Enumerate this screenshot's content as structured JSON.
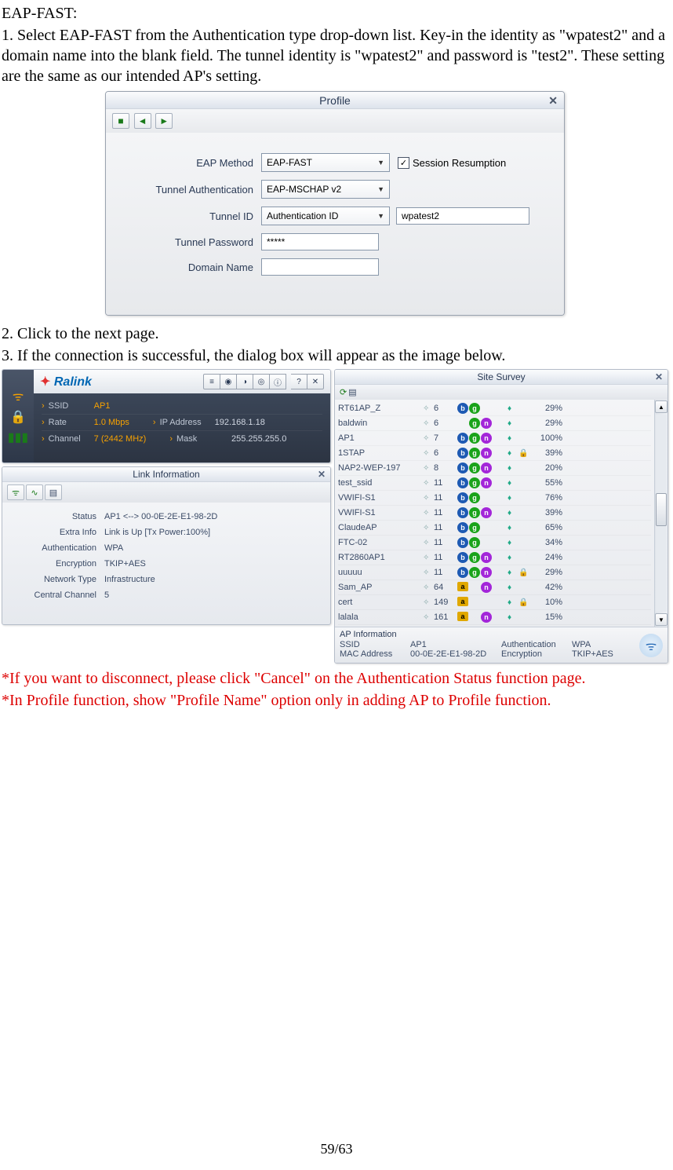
{
  "text": {
    "heading": "EAP-FAST:",
    "step1": "1. Select EAP-FAST from the Authentication type drop-down list. Key-in the identity as \"wpatest2\" and a domain name into the blank field. The tunnel identity is \"wpatest2\" and password is \"test2\". These setting are the same as our intended AP's setting.",
    "step2": "2. Click to the next page.",
    "step3": "3. If the connection is successful, the dialog box will appear as the image below.",
    "note1": "*If you want to disconnect, please click \"Cancel\" on the Authentication Status function page.",
    "note2": "*In Profile function, show \"Profile Name\" option only in adding AP to Profile function.",
    "pagenum": "59/63"
  },
  "profile": {
    "title": "Profile",
    "rows": {
      "eap_label": "EAP Method",
      "eap_value": "EAP-FAST",
      "session_label": "Session Resumption",
      "tunnel_auth_label": "Tunnel Authentication",
      "tunnel_auth_value": "EAP-MSCHAP v2",
      "tunnel_id_label": "Tunnel ID",
      "tunnel_id_value": "Authentication ID",
      "tunnel_id_input": "wpatest2",
      "tunnel_pw_label": "Tunnel Password",
      "tunnel_pw_value": "*****",
      "domain_label": "Domain Name",
      "domain_value": ""
    }
  },
  "ralink": {
    "logo": "Ralink",
    "ssid_label": "SSID",
    "ssid_value": "AP1",
    "rate_label": "Rate",
    "rate_value": "1.0 Mbps",
    "ip_label": "IP Address",
    "ip_value": "192.168.1.18",
    "channel_label": "Channel",
    "channel_value": "7 (2442 MHz)",
    "mask_label": "Mask",
    "mask_value": "255.255.255.0"
  },
  "linkinfo": {
    "title": "Link Information",
    "rows": [
      {
        "label": "Status",
        "value": "AP1 <--> 00-0E-2E-E1-98-2D"
      },
      {
        "label": "Extra Info",
        "value": "Link is Up [Tx Power:100%]"
      },
      {
        "label": "Authentication",
        "value": "WPA"
      },
      {
        "label": "Encryption",
        "value": "TKIP+AES"
      },
      {
        "label": "Network Type",
        "value": "Infrastructure"
      },
      {
        "label": "Central Channel",
        "value": "5"
      }
    ]
  },
  "site": {
    "title": "Site Survey",
    "rows": [
      {
        "ssid": "RT61AP_Z",
        "ch": "6",
        "badges": [
          "b",
          "g",
          "",
          ""
        ],
        "sec": "1",
        "lock": "",
        "pct": "29%"
      },
      {
        "ssid": "baldwin",
        "ch": "6",
        "badges": [
          "",
          "g",
          "n",
          ""
        ],
        "sec": "1",
        "lock": "",
        "pct": "29%"
      },
      {
        "ssid": "AP1",
        "ch": "7",
        "badges": [
          "b",
          "g",
          "n",
          ""
        ],
        "sec": "1",
        "lock": "",
        "pct": "100%"
      },
      {
        "ssid": "1STAP",
        "ch": "6",
        "badges": [
          "b",
          "g",
          "n",
          ""
        ],
        "sec": "1",
        "lock": "1",
        "pct": "39%"
      },
      {
        "ssid": "NAP2-WEP-197",
        "ch": "8",
        "badges": [
          "b",
          "g",
          "n",
          ""
        ],
        "sec": "1",
        "lock": "",
        "pct": "20%"
      },
      {
        "ssid": "test_ssid",
        "ch": "11",
        "badges": [
          "b",
          "g",
          "n",
          ""
        ],
        "sec": "1",
        "lock": "",
        "pct": "55%"
      },
      {
        "ssid": "VWIFI-S1",
        "ch": "11",
        "badges": [
          "b",
          "g",
          "",
          ""
        ],
        "sec": "1",
        "lock": "",
        "pct": "76%"
      },
      {
        "ssid": "VWIFI-S1",
        "ch": "11",
        "badges": [
          "b",
          "g",
          "n",
          ""
        ],
        "sec": "1",
        "lock": "",
        "pct": "39%"
      },
      {
        "ssid": "ClaudeAP",
        "ch": "11",
        "badges": [
          "b",
          "g",
          "",
          ""
        ],
        "sec": "1",
        "lock": "",
        "pct": "65%"
      },
      {
        "ssid": "FTC-02",
        "ch": "11",
        "badges": [
          "b",
          "g",
          "",
          ""
        ],
        "sec": "1",
        "lock": "",
        "pct": "34%"
      },
      {
        "ssid": "RT2860AP1",
        "ch": "11",
        "badges": [
          "b",
          "g",
          "n",
          ""
        ],
        "sec": "1",
        "lock": "",
        "pct": "24%"
      },
      {
        "ssid": "uuuuu",
        "ch": "11",
        "badges": [
          "b",
          "g",
          "n",
          ""
        ],
        "sec": "1",
        "lock": "1",
        "pct": "29%"
      },
      {
        "ssid": "Sam_AP",
        "ch": "64",
        "badges": [
          "a",
          "",
          "n",
          ""
        ],
        "sec": "1",
        "lock": "",
        "pct": "42%"
      },
      {
        "ssid": "cert",
        "ch": "149",
        "badges": [
          "a",
          "",
          "",
          ""
        ],
        "sec": "1",
        "lock": "1",
        "pct": "10%"
      },
      {
        "ssid": "lalala",
        "ch": "161",
        "badges": [
          "a",
          "",
          "n",
          ""
        ],
        "sec": "1",
        "lock": "",
        "pct": "15%"
      }
    ],
    "apinfo": {
      "title": "AP Information",
      "ssid_label": "SSID",
      "ssid_value": "AP1",
      "auth_label": "Authentication",
      "auth_value": "WPA",
      "mac_label": "MAC Address",
      "mac_value": "00-0E-2E-E1-98-2D",
      "enc_label": "Encryption",
      "enc_value": "TKIP+AES"
    }
  }
}
